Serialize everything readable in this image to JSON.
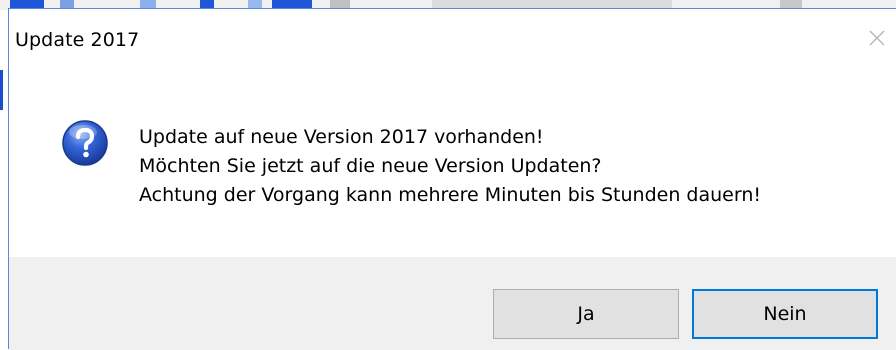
{
  "window": {
    "title": "Update 2017"
  },
  "icons": {
    "close": "close-icon",
    "dialog": "question-icon"
  },
  "message": {
    "lines": [
      "Update auf neue Version 2017 vorhanden!",
      "Möchten Sie jetzt auf die neue Version Updaten?",
      "Achtung der Vorgang kann mehrere Minuten bis Stunden dauern!"
    ]
  },
  "buttons": {
    "yes_label": "Ja",
    "no_label": "Nein"
  },
  "colors": {
    "accent": "#0078d7",
    "footer_bg": "#f0f0f0",
    "button_bg": "#e1e1e1",
    "icon_blue": "#2b55c8"
  }
}
